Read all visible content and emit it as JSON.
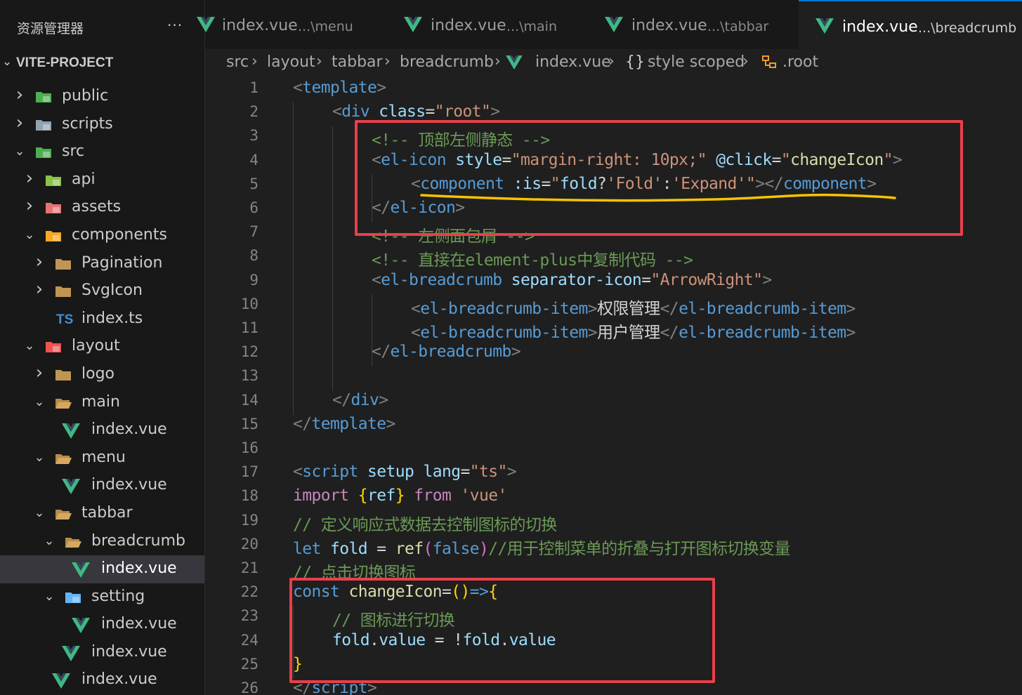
{
  "sidebar": {
    "title": "资源管理器",
    "more": "···",
    "project": "VITE-PROJECT",
    "tree": [
      {
        "label": "public",
        "icon": "public-folder-icon",
        "chev": "›",
        "depth": 0
      },
      {
        "label": "scripts",
        "icon": "scripts-folder-icon",
        "chev": "›",
        "depth": 0
      },
      {
        "label": "src",
        "icon": "src-folder-icon",
        "chev": "⌄",
        "depth": 0
      },
      {
        "label": "api",
        "icon": "api-folder-icon",
        "chev": "›",
        "depth": 1
      },
      {
        "label": "assets",
        "icon": "assets-folder-icon",
        "chev": "›",
        "depth": 1
      },
      {
        "label": "components",
        "icon": "components-folder-icon",
        "chev": "⌄",
        "depth": 1
      },
      {
        "label": "Pagination",
        "icon": "folder-icon",
        "chev": "›",
        "depth": 2
      },
      {
        "label": "SvgIcon",
        "icon": "folder-icon",
        "chev": "›",
        "depth": 2
      },
      {
        "label": "index.ts",
        "icon": "ts-file-icon",
        "chev": "",
        "depth": 2
      },
      {
        "label": "layout",
        "icon": "layout-folder-icon",
        "chev": "⌄",
        "depth": 1
      },
      {
        "label": "logo",
        "icon": "folder-icon",
        "chev": "›",
        "depth": 2
      },
      {
        "label": "main",
        "icon": "folder-open-icon",
        "chev": "⌄",
        "depth": 2
      },
      {
        "label": "index.vue",
        "icon": "vue-file-icon",
        "chev": "",
        "depth": 3
      },
      {
        "label": "menu",
        "icon": "folder-open-icon",
        "chev": "⌄",
        "depth": 2
      },
      {
        "label": "index.vue",
        "icon": "vue-file-icon",
        "chev": "",
        "depth": 3
      },
      {
        "label": "tabbar",
        "icon": "folder-open-icon",
        "chev": "⌄",
        "depth": 2
      },
      {
        "label": "breadcrumb",
        "icon": "folder-open-icon",
        "chev": "⌄",
        "depth": 3
      },
      {
        "label": "index.vue",
        "icon": "vue-file-icon",
        "chev": "",
        "depth": 4,
        "selected": true
      },
      {
        "label": "setting",
        "icon": "setting-folder-icon",
        "chev": "⌄",
        "depth": 3
      },
      {
        "label": "index.vue",
        "icon": "vue-file-icon",
        "chev": "",
        "depth": 4
      },
      {
        "label": "index.vue",
        "icon": "vue-file-icon",
        "chev": "",
        "depth": 3
      },
      {
        "label": "index.vue",
        "icon": "vue-file-icon",
        "chev": "",
        "depth": 2
      }
    ]
  },
  "tabs": [
    {
      "name": "index.vue",
      "desc": "...\\menu",
      "active": false
    },
    {
      "name": "index.vue",
      "desc": "...\\main",
      "active": false
    },
    {
      "name": "index.vue",
      "desc": "...\\tabbar",
      "active": false
    },
    {
      "name": "index.vue",
      "desc": "...\\breadcrumb",
      "active": true
    }
  ],
  "breadcrumb": [
    {
      "label": "src",
      "icon": ""
    },
    {
      "label": "layout",
      "icon": ""
    },
    {
      "label": "tabbar",
      "icon": ""
    },
    {
      "label": "breadcrumb",
      "icon": ""
    },
    {
      "label": "index.vue",
      "icon": "vue-file-icon"
    },
    {
      "label": "style scoped",
      "icon": "braces-icon"
    },
    {
      "label": ".root",
      "icon": "symbol-class-icon"
    }
  ],
  "breadcrumb_sep": "›",
  "code": [
    {
      "n": "1",
      "indent": 0,
      "t": [
        [
          "tk-punct",
          "<"
        ],
        [
          "tk-tag",
          "template"
        ],
        [
          "tk-punct",
          ">"
        ]
      ]
    },
    {
      "n": "2",
      "indent": 1,
      "t": [
        [
          "tk-punct",
          "<"
        ],
        [
          "tk-tag",
          "div"
        ],
        [
          "tk-text",
          " "
        ],
        [
          "tk-attr",
          "class"
        ],
        [
          "tk-op",
          "="
        ],
        [
          "tk-str",
          "\"root\""
        ],
        [
          "tk-punct",
          ">"
        ]
      ]
    },
    {
      "n": "3",
      "indent": 2,
      "t": [
        [
          "tk-com",
          "<!-- 顶部左侧静态 -->"
        ]
      ]
    },
    {
      "n": "4",
      "indent": 2,
      "t": [
        [
          "tk-punct",
          "<"
        ],
        [
          "tk-tag",
          "el-icon"
        ],
        [
          "tk-text",
          " "
        ],
        [
          "tk-attr",
          "style"
        ],
        [
          "tk-op",
          "="
        ],
        [
          "tk-str",
          "\"margin-right: 10px;\""
        ],
        [
          "tk-text",
          " "
        ],
        [
          "tk-attr",
          "@click"
        ],
        [
          "tk-op",
          "="
        ],
        [
          "tk-str",
          "\""
        ],
        [
          "tk-fn",
          "changeIcon"
        ],
        [
          "tk-str",
          "\""
        ],
        [
          "tk-punct",
          ">"
        ]
      ]
    },
    {
      "n": "5",
      "indent": 3,
      "t": [
        [
          "tk-punct",
          "<"
        ],
        [
          "tk-tag",
          "component"
        ],
        [
          "tk-text",
          " "
        ],
        [
          "tk-attr",
          ":is"
        ],
        [
          "tk-op",
          "="
        ],
        [
          "tk-str",
          "\""
        ],
        [
          "tk-var",
          "fold"
        ],
        [
          "tk-op",
          "?"
        ],
        [
          "tk-str",
          "'Fold'"
        ],
        [
          "tk-op",
          ":"
        ],
        [
          "tk-str",
          "'Expand'"
        ],
        [
          "tk-str",
          "\""
        ],
        [
          "tk-punct",
          "></"
        ],
        [
          "tk-tag",
          "component"
        ],
        [
          "tk-punct",
          ">"
        ]
      ]
    },
    {
      "n": "6",
      "indent": 2,
      "t": [
        [
          "tk-punct",
          "</"
        ],
        [
          "tk-tag",
          "el-icon"
        ],
        [
          "tk-punct",
          ">"
        ]
      ]
    },
    {
      "n": "7",
      "indent": 2,
      "t": [
        [
          "tk-com",
          "<!-- 左侧面包屑 -->"
        ]
      ]
    },
    {
      "n": "8",
      "indent": 2,
      "t": [
        [
          "tk-com",
          "<!-- 直接在element-plus中复制代码 -->"
        ]
      ]
    },
    {
      "n": "9",
      "indent": 2,
      "t": [
        [
          "tk-punct",
          "<"
        ],
        [
          "tk-tag",
          "el-breadcrumb"
        ],
        [
          "tk-text",
          " "
        ],
        [
          "tk-attr",
          "separator-icon"
        ],
        [
          "tk-op",
          "="
        ],
        [
          "tk-str",
          "\"ArrowRight\""
        ],
        [
          "tk-punct",
          ">"
        ]
      ]
    },
    {
      "n": "10",
      "indent": 3,
      "t": [
        [
          "tk-punct",
          "<"
        ],
        [
          "tk-tag",
          "el-breadcrumb-item"
        ],
        [
          "tk-punct",
          ">"
        ],
        [
          "tk-text",
          "权限管理"
        ],
        [
          "tk-punct",
          "</"
        ],
        [
          "tk-tag",
          "el-breadcrumb-item"
        ],
        [
          "tk-punct",
          ">"
        ]
      ]
    },
    {
      "n": "11",
      "indent": 3,
      "t": [
        [
          "tk-punct",
          "<"
        ],
        [
          "tk-tag",
          "el-breadcrumb-item"
        ],
        [
          "tk-punct",
          ">"
        ],
        [
          "tk-text",
          "用户管理"
        ],
        [
          "tk-punct",
          "</"
        ],
        [
          "tk-tag",
          "el-breadcrumb-item"
        ],
        [
          "tk-punct",
          ">"
        ]
      ]
    },
    {
      "n": "12",
      "indent": 2,
      "t": [
        [
          "tk-punct",
          "</"
        ],
        [
          "tk-tag",
          "el-breadcrumb"
        ],
        [
          "tk-punct",
          ">"
        ]
      ]
    },
    {
      "n": "13",
      "indent": 0,
      "t": []
    },
    {
      "n": "14",
      "indent": 1,
      "t": [
        [
          "tk-punct",
          "</"
        ],
        [
          "tk-tag",
          "div"
        ],
        [
          "tk-punct",
          ">"
        ]
      ]
    },
    {
      "n": "15",
      "indent": 0,
      "t": [
        [
          "tk-punct",
          "</"
        ],
        [
          "tk-tag",
          "template"
        ],
        [
          "tk-punct",
          ">"
        ]
      ]
    },
    {
      "n": "16",
      "indent": 0,
      "t": []
    },
    {
      "n": "17",
      "indent": 0,
      "t": [
        [
          "tk-punct",
          "<"
        ],
        [
          "tk-tag",
          "script"
        ],
        [
          "tk-text",
          " "
        ],
        [
          "tk-attr",
          "setup"
        ],
        [
          "tk-text",
          " "
        ],
        [
          "tk-attr",
          "lang"
        ],
        [
          "tk-op",
          "="
        ],
        [
          "tk-str",
          "\"ts\""
        ],
        [
          "tk-punct",
          ">"
        ]
      ]
    },
    {
      "n": "18",
      "indent": 0,
      "t": [
        [
          "tk-ctl",
          "import"
        ],
        [
          "tk-text",
          " "
        ],
        [
          "tk-brace",
          "{"
        ],
        [
          "tk-var",
          "ref"
        ],
        [
          "tk-brace",
          "}"
        ],
        [
          "tk-text",
          " "
        ],
        [
          "tk-ctl",
          "from"
        ],
        [
          "tk-text",
          " "
        ],
        [
          "tk-str",
          "'vue'"
        ]
      ]
    },
    {
      "n": "19",
      "indent": 0,
      "t": [
        [
          "tk-com",
          "// 定义响应式数据去控制图标的切换"
        ]
      ]
    },
    {
      "n": "20",
      "indent": 0,
      "t": [
        [
          "tk-kw",
          "let"
        ],
        [
          "tk-text",
          " "
        ],
        [
          "tk-var",
          "fold"
        ],
        [
          "tk-text",
          " "
        ],
        [
          "tk-op",
          "="
        ],
        [
          "tk-text",
          " "
        ],
        [
          "tk-fn",
          "ref"
        ],
        [
          "tk-paren",
          "("
        ],
        [
          "tk-kw",
          "false"
        ],
        [
          "tk-paren",
          ")"
        ],
        [
          "tk-com",
          "//用于控制菜单的折叠与打开图标切换变量"
        ]
      ]
    },
    {
      "n": "21",
      "indent": 0,
      "t": [
        [
          "tk-com",
          "// 点击切换图标"
        ]
      ]
    },
    {
      "n": "22",
      "indent": 0,
      "t": [
        [
          "tk-kw",
          "const"
        ],
        [
          "tk-text",
          " "
        ],
        [
          "tk-fn",
          "changeIcon"
        ],
        [
          "tk-op",
          "="
        ],
        [
          "tk-brace",
          "()"
        ],
        [
          "tk-kw",
          "=>"
        ],
        [
          "tk-brace",
          "{"
        ]
      ]
    },
    {
      "n": "23",
      "indent": 1,
      "t": [
        [
          "tk-com",
          "// 图标进行切换"
        ]
      ]
    },
    {
      "n": "24",
      "indent": 1,
      "t": [
        [
          "tk-var",
          "fold"
        ],
        [
          "tk-op",
          "."
        ],
        [
          "tk-var",
          "value"
        ],
        [
          "tk-text",
          " "
        ],
        [
          "tk-op",
          "="
        ],
        [
          "tk-text",
          " "
        ],
        [
          "tk-op",
          "!"
        ],
        [
          "tk-var",
          "fold"
        ],
        [
          "tk-op",
          "."
        ],
        [
          "tk-var",
          "value"
        ]
      ]
    },
    {
      "n": "25",
      "indent": 0,
      "t": [
        [
          "tk-brace",
          "}"
        ]
      ]
    },
    {
      "n": "26",
      "indent": 0,
      "t": [
        [
          "tk-punct",
          "</"
        ],
        [
          "tk-tag",
          "script"
        ],
        [
          "tk-punct",
          ">"
        ]
      ]
    }
  ],
  "colors": {
    "annotation_red": "#e8404a",
    "annotation_yellow": "#f5c400",
    "vue_green": "#41b883",
    "accent_blue": "#0078d4"
  }
}
